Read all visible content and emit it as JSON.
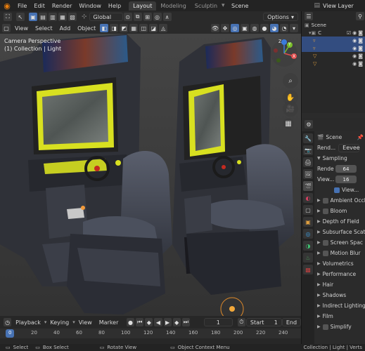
{
  "topbar": {
    "menus": [
      "File",
      "Edit",
      "Render",
      "Window",
      "Help"
    ],
    "workspaces": [
      "Layout",
      "Modeling",
      "Sculptin"
    ],
    "scene_label": "Scene",
    "view_layer_label": "View Layer"
  },
  "viewport_header": {
    "orientation_label": "Global",
    "options_label": "Options",
    "menus": [
      "View",
      "Select",
      "Add",
      "Object"
    ]
  },
  "viewport": {
    "camera_label": "Camera Perspective",
    "collection_label": "(1) Collection | Light",
    "gizmo_axes": [
      "X",
      "Y",
      "Z"
    ]
  },
  "outliner": {
    "rows": [
      {
        "label": "Scene"
      },
      {
        "label": "C"
      },
      {
        "label": ""
      },
      {
        "label": ""
      },
      {
        "label": ""
      },
      {
        "label": ""
      }
    ]
  },
  "properties": {
    "header_label": "Scene",
    "render_engine_label": "Rend...",
    "render_engine_value": "Eevee",
    "sampling": {
      "title": "Sampling",
      "render_label": "Rende",
      "render_value": "64",
      "viewport_label": "View...",
      "viewport_value": "16",
      "viewport_denoise_label": "View..."
    },
    "panels": [
      {
        "label": "Ambient Occl",
        "checkbox": true
      },
      {
        "label": "Bloom",
        "checkbox": true
      },
      {
        "label": "Depth of Field",
        "checkbox": false
      },
      {
        "label": "Subsurface Scat",
        "checkbox": false
      },
      {
        "label": "Screen Spac",
        "checkbox": true
      },
      {
        "label": "Motion Blur",
        "checkbox": true
      },
      {
        "label": "Volumetrics",
        "checkbox": false
      },
      {
        "label": "Performance",
        "checkbox": false
      },
      {
        "label": "Hair",
        "checkbox": false
      },
      {
        "label": "Shadows",
        "checkbox": false
      },
      {
        "label": "Indirect Lighting",
        "checkbox": false
      },
      {
        "label": "Film",
        "checkbox": false
      },
      {
        "label": "Simplify",
        "checkbox": true
      }
    ]
  },
  "timeline": {
    "menus": [
      "Playback",
      "Keying",
      "View",
      "Marker"
    ],
    "current_frame": "1",
    "start_label": "Start",
    "start_value": "1",
    "end_label": "End",
    "ruler": [
      "0",
      "20",
      "40",
      "60",
      "80",
      "100",
      "120",
      "140",
      "160",
      "180",
      "200",
      "220",
      "240"
    ]
  },
  "statusbar": {
    "select": "Select",
    "box_select": "Box Select",
    "rotate_view": "Rotate View",
    "context_menu": "Object Context Menu",
    "stats": "Collection | Light | Verts"
  },
  "colors": {
    "accent": "#4772b3",
    "screen_yellow": "#d8e020",
    "viewport_bg": "#3d3d3d"
  }
}
